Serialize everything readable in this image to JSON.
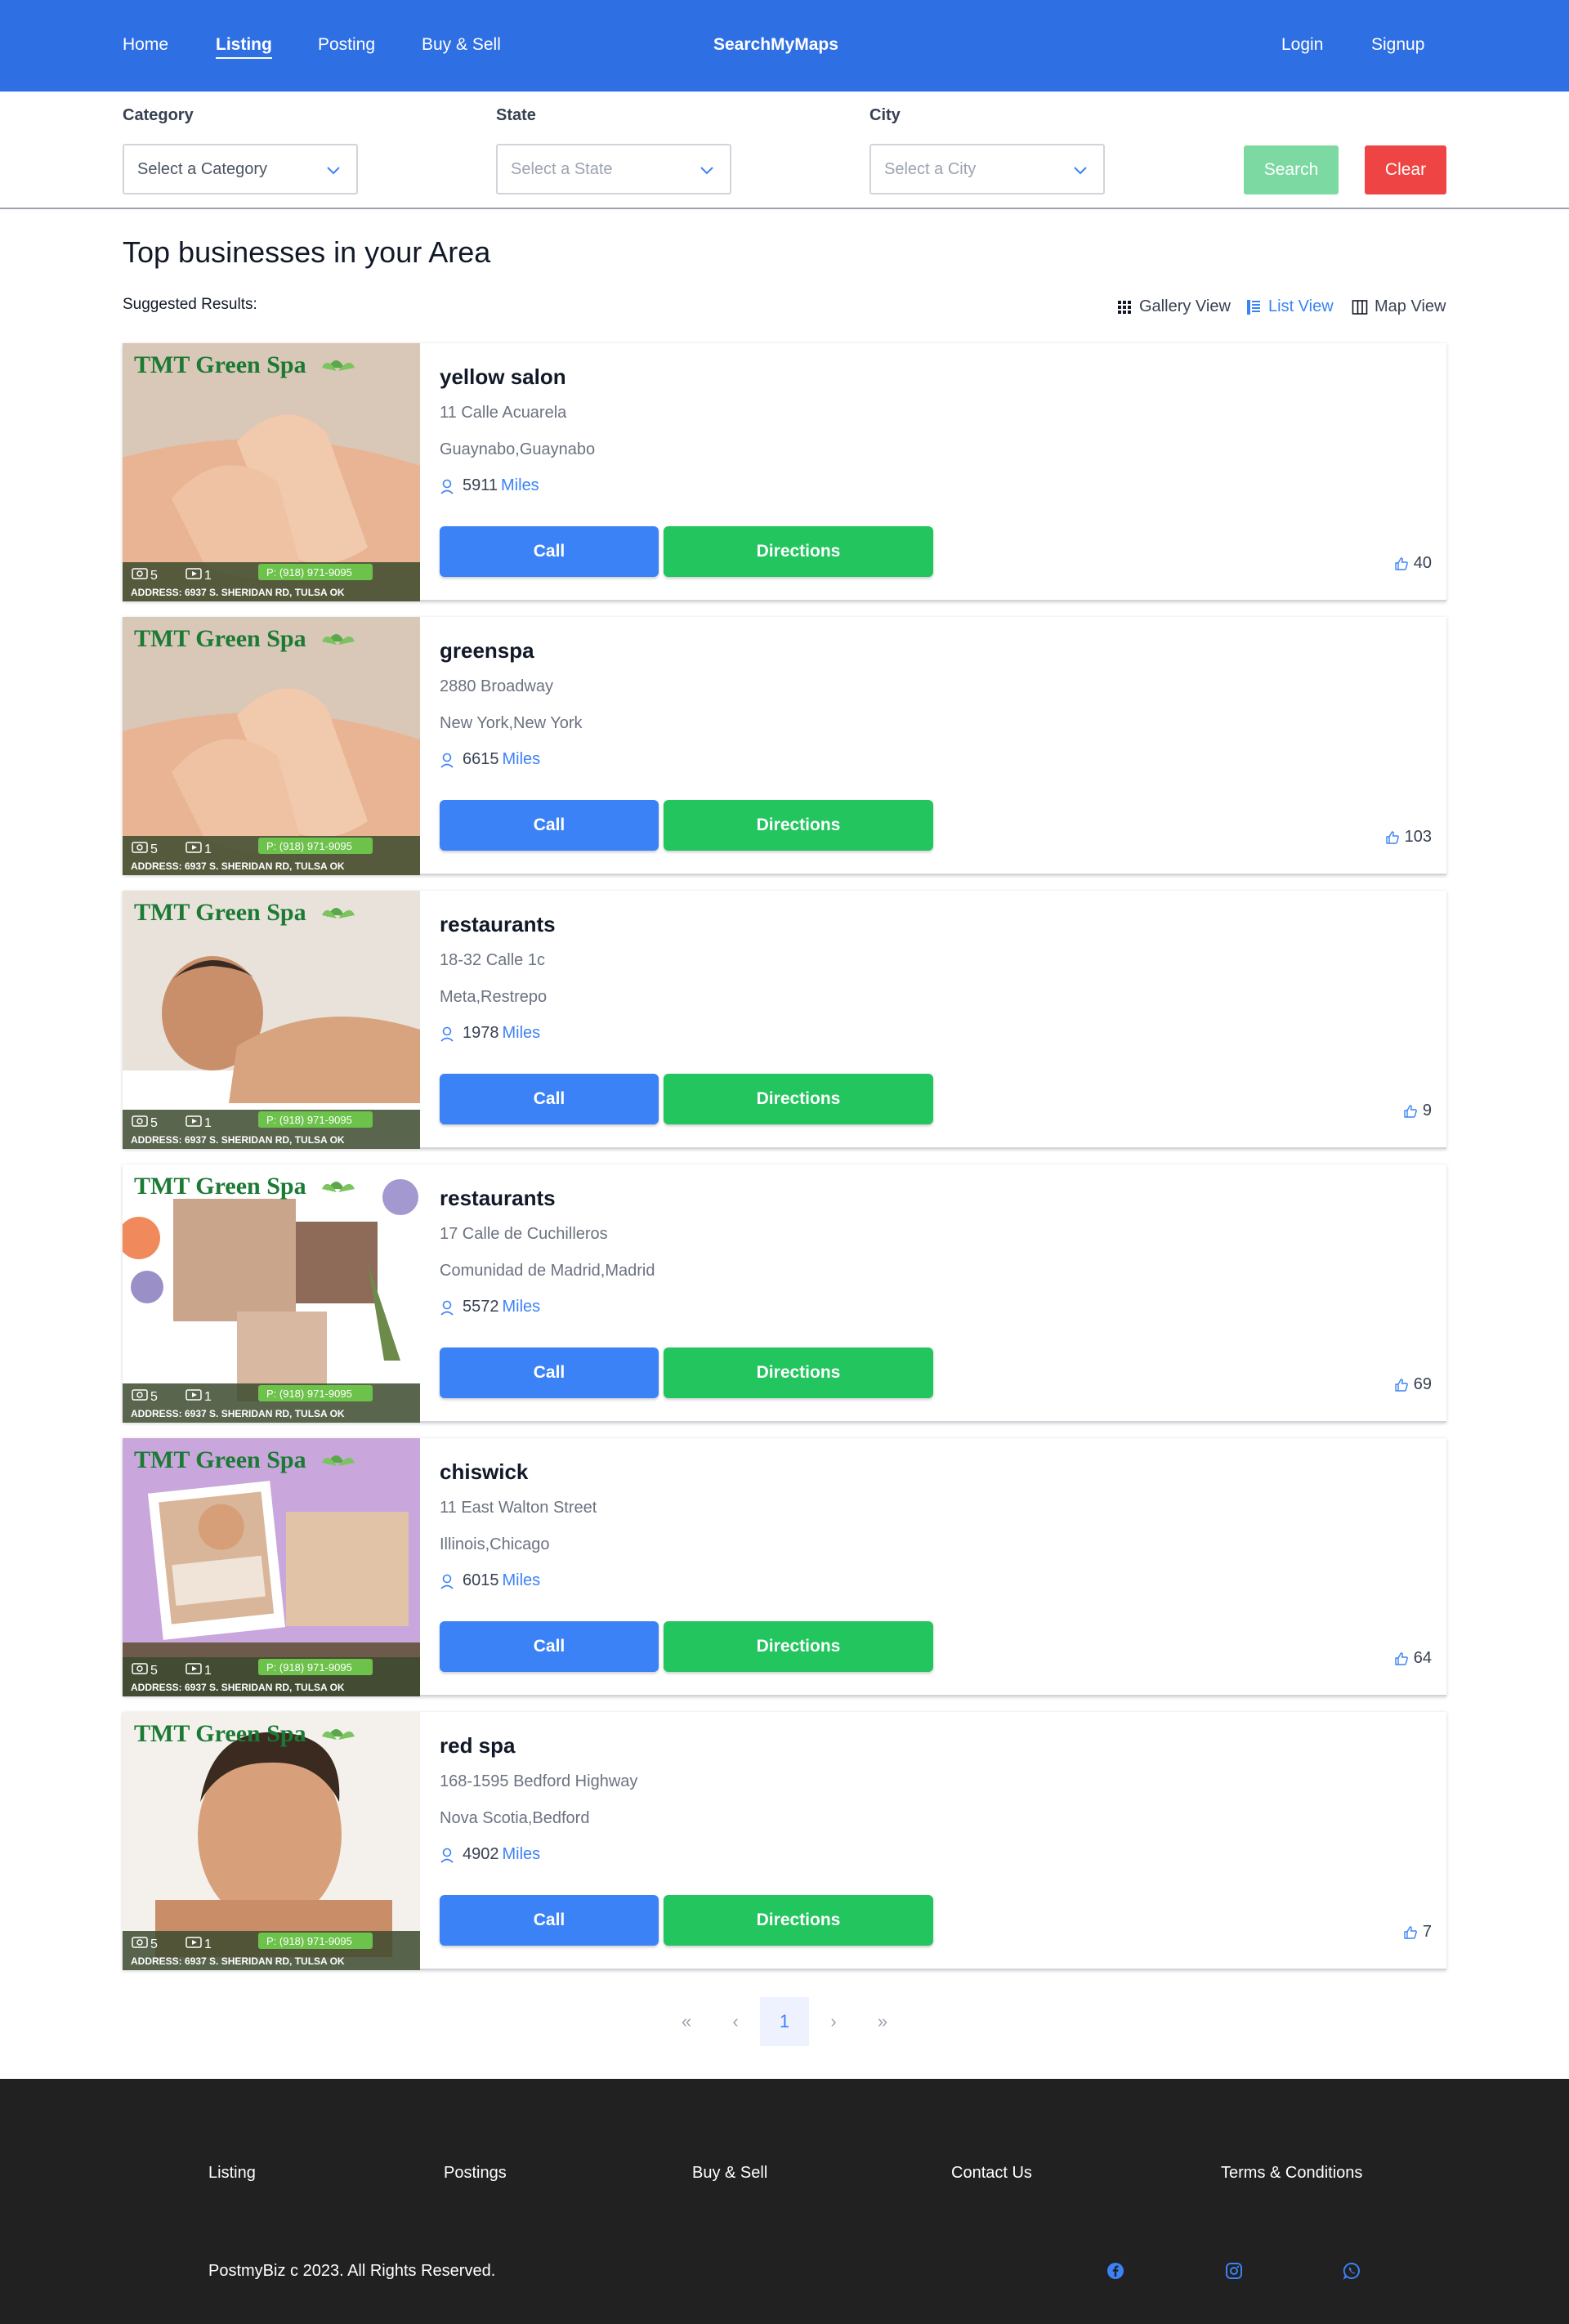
{
  "nav": {
    "links": [
      "Home",
      "Listing",
      "Posting",
      "Buy & Sell"
    ],
    "brand": "SearchMyMaps",
    "login": "Login",
    "signup": "Signup",
    "color": "#2f6fe4"
  },
  "filters": {
    "category_label": "Category",
    "category_value": "Select a Category",
    "state_label": "State",
    "state_value": "Select a State",
    "city_label": "City",
    "city_value": "Select a City",
    "search": "Search",
    "clear": "Clear"
  },
  "main": {
    "title": "Top businesses in your Area",
    "suggested": "Suggested Results:",
    "views": [
      "Gallery View",
      "List View",
      "Map View"
    ],
    "active_view": "List View"
  },
  "listings": [
    {
      "name": "yellow salon",
      "address": "11 Calle Acuarela",
      "city": "Guaynabo,Guaynabo",
      "distance": "5911",
      "unit": "Miles",
      "call": "Call",
      "directions": "Directions",
      "likes": "40"
    },
    {
      "name": "greenspa",
      "address": "2880 Broadway",
      "city": "New York,New York",
      "distance": "6615",
      "unit": "Miles",
      "call": "Call",
      "directions": "Directions",
      "likes": "103"
    },
    {
      "name": "restaurants",
      "address": "18-32 Calle 1c",
      "city": "Meta,Restrepo",
      "distance": "1978",
      "unit": "Miles",
      "call": "Call",
      "directions": "Directions",
      "likes": "9"
    },
    {
      "name": "restaurants",
      "address": "17 Calle de Cuchilleros",
      "city": "Comunidad de Madrid,Madrid",
      "distance": "5572",
      "unit": "Miles",
      "call": "Call",
      "directions": "Directions",
      "likes": "69"
    },
    {
      "name": "chiswick",
      "address": "11 East Walton Street",
      "city": "Illinois,Chicago",
      "distance": "6015",
      "unit": "Miles",
      "call": "Call",
      "directions": "Directions",
      "likes": "64"
    },
    {
      "name": "red spa",
      "address": "168-1595 Bedford Highway",
      "city": "Nova Scotia,Bedford",
      "distance": "4902",
      "unit": "Miles",
      "call": "Call",
      "directions": "Directions",
      "likes": "7"
    }
  ],
  "thumbnail": {
    "title": "TMT Green Spa",
    "phone": "P: (918) 971-9095",
    "address": "ADDRESS: 6937 S. SHERIDAN RD, TULSA OK",
    "photo_count": "5",
    "video_count": "1"
  },
  "pagination": {
    "first": "«",
    "prev": "‹",
    "current": "1",
    "next": "›",
    "last": "»"
  },
  "footer": {
    "links": [
      "Listing",
      "Postings",
      "Buy & Sell",
      "Contact Us",
      "Terms & Conditions"
    ],
    "copyright": "PostmyBiz c 2023. All Rights Reserved.",
    "social_icons": [
      "facebook-icon",
      "instagram-icon",
      "whatsapp-icon"
    ]
  }
}
